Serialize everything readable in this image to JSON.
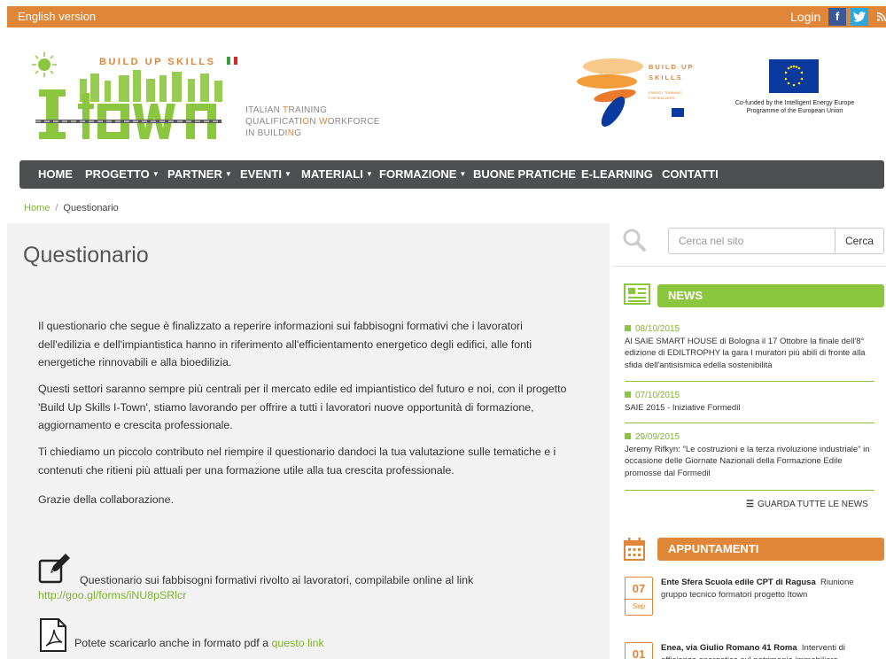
{
  "topbar": {
    "language": "English version",
    "login": "Login",
    "facebook": "f",
    "twitter": "t",
    "rss": "rss"
  },
  "header": {
    "logo_top": "BUILD UP SKILLS",
    "logo_main": "I-town",
    "tagline_lines": [
      "ITALIAN  TRAINING",
      "QUALIFICATION  WORKFORCE",
      "IN BUILDING"
    ],
    "bus_logo": [
      "BUILD UP",
      "SKILLS"
    ],
    "bus_sub": [
      "ENERGY TRAINING",
      "FOR BUILDERS"
    ],
    "eu_text": "Co-funded by the Intelligent Energy Europe Programme of the European Union"
  },
  "nav": {
    "home": "HOME",
    "progetto": "PROGETTO",
    "partner": "PARTNER",
    "eventi": "EVENTI",
    "materiali": "MATERIALI",
    "formazione": "FORMAZIONE",
    "buone_pratiche": "BUONE PRATICHE",
    "elearning": "E-LEARNING",
    "contatti": "CONTATTI"
  },
  "breadcrumb": {
    "home": "Home",
    "separator": "/",
    "current": "Questionario"
  },
  "main": {
    "title": "Questionario",
    "p1": "Il questionario che segue è finalizzato a reperire informazioni sui fabbisogni formativi che i lavoratori dell'edilizia e dell'impiantistica hanno in riferimento all'efficientamento energetico degli edifici, alle fonti energetiche rinnovabili e alla bioedilizia.",
    "p2": "Questi settori saranno sempre più centrali per il mercato edile ed impiantistico del futuro e noi, con il progetto 'Build Up Skills I-Town', stiamo lavorando per offrire a tutti i lavoratori nuove opportunità di formazione, aggiornamento e crescita professionale.",
    "p3": "Ti chiediamo un piccolo contributo nel riempire il questionario dandoci la tua valutazione sulle tematiche e i contenuti che ritieni più attuali per una formazione utile alla tua crescita professionale.",
    "p4": "Grazie della collaborazione.",
    "online_text": "Questionario sui fabbisogni formativi rivolto ai lavoratori, compilabile online al link",
    "online_link": "http://goo.gl/forms/iNU8pSRlcr",
    "pdf_text": "Potete scaricarlo anche in formato pdf a",
    "pdf_link": "questo link"
  },
  "sidebar": {
    "search_placeholder": "Cerca nel sito",
    "search_button": "Cerca",
    "news_title": "NEWS",
    "news": [
      {
        "date": "08/10/2015",
        "text": "Al SAIE SMART HOUSE di Bologna il 17 Ottobre la finale dell'8° edizione di EDILTROPHY la gara I muratori più abili di fronte alla sfida dell'antisismica edella sostenibilità"
      },
      {
        "date": "07/10/2015",
        "text": "SAIE 2015 - Iniziative Formedil"
      },
      {
        "date": "29/09/2015",
        "text": "Jeremy Rifkyn: \"Le costruzioni e la terza rivoluzione industriale\" in occasione delle Giornate Nazionali della Formazione Edile promosse dal Formedil"
      }
    ],
    "all_news": "GUARDA TUTTE LE NEWS",
    "appointments_title": "APPUNTAMENTI",
    "appointments": [
      {
        "day": "07",
        "month": "Sep",
        "place": "Ente Sfera Scuola edile CPT di Ragusa",
        "text": "Riunione gruppo tecnico formatori progetto Itown"
      },
      {
        "day": "01",
        "month": "",
        "place": "Enea, via Giulio Romano 41 Roma",
        "text": "Interventi di efficienza energetica sul patrimonio immobiliare"
      }
    ]
  },
  "colors": {
    "orange": "#e08638",
    "green": "#8cc63f",
    "nav": "#4d4f51"
  }
}
